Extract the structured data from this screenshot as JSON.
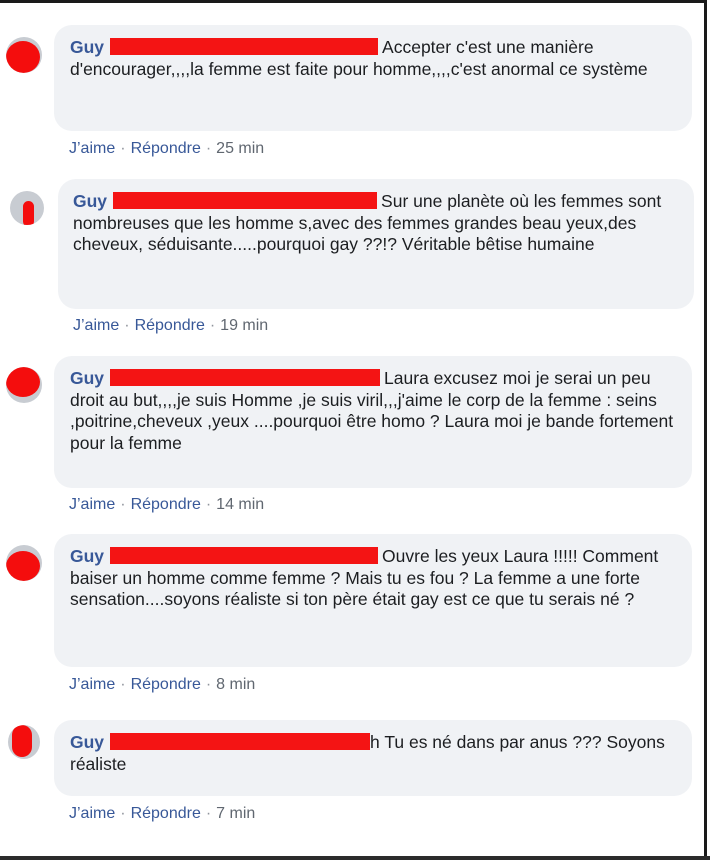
{
  "comments": [
    {
      "author": "Guy",
      "text": "Accepter c'est une manière d'encourager,,,,la femme est faite pour homme,,,,c'est anormal ce système",
      "like": "J’aime",
      "reply": "Répondre",
      "time": "25 min"
    },
    {
      "author": "Guy",
      "text": "Sur une planète où les femmes sont nombreuses que les homme s,avec des femmes grandes beau yeux,des cheveux, séduisante.....pourquoi gay ??!? Véritable bêtise humaine",
      "like": "J’aime",
      "reply": "Répondre",
      "time": "19 min"
    },
    {
      "author": "Guy",
      "text": "Laura excusez moi je serai un peu droit au but,,,,je suis Homme ,je suis viril,,,j'aime le corp de la femme : seins ,poitrine,cheveux ,yeux ....pourquoi être homo ? Laura moi je bande fortement pour la femme",
      "like": "J’aime",
      "reply": "Répondre",
      "time": "14 min"
    },
    {
      "author": "Guy",
      "text": "Ouvre les yeux Laura !!!!! Comment baiser un homme comme femme ? Mais tu es fou ? La femme a une forte sensation....soyons réaliste si ton père était gay est ce que tu serais né ?",
      "like": "J’aime",
      "reply": "Répondre",
      "time": "8 min"
    },
    {
      "author": "Guy",
      "text": "h Tu es né dans par anus ??? Soyons réaliste",
      "like": "J’aime",
      "reply": "Répondre",
      "time": "7 min"
    }
  ],
  "colors": {
    "bubble": "#f0f2f5",
    "link": "#385898",
    "redaction": "#f41414",
    "meta": "#606770"
  }
}
